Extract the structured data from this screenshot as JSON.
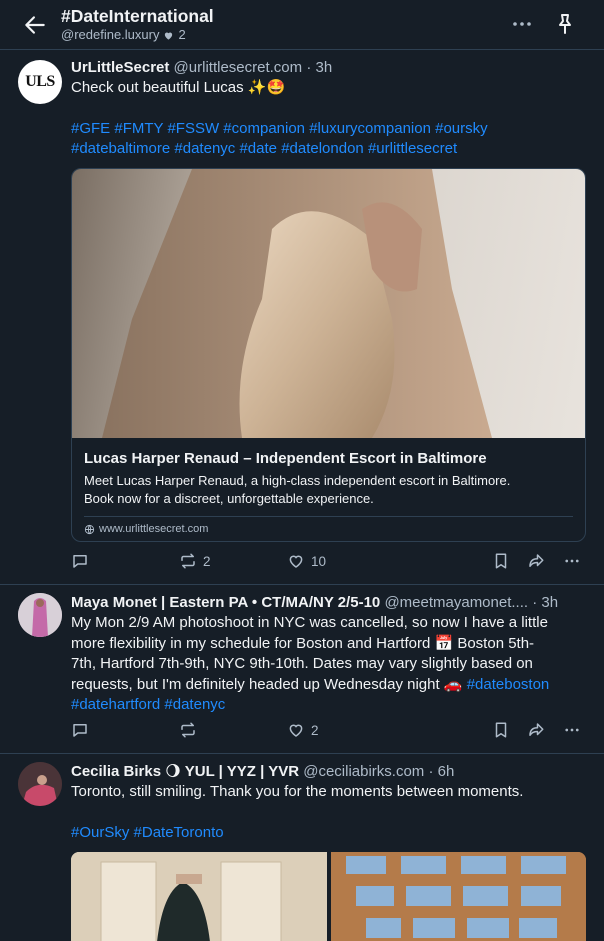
{
  "header": {
    "title": "#DateInternational",
    "subtitle": "@redefine.luxury",
    "likes": "2"
  },
  "posts": [
    {
      "name": "UrLittleSecret",
      "handle": "@urlittlesecret.com",
      "time": "· 3h",
      "avatar_text": "ULS",
      "text": "Check out beautiful Lucas ✨🤩",
      "tags_line1": [
        "#GFE",
        "#FMTY",
        "#FSSW",
        "#companion",
        "#luxurycompanion",
        "#oursky"
      ],
      "tags_line2": [
        "#datebaltimore",
        "#datenyc",
        "#date",
        "#datelondon",
        "#urlittlesecret"
      ],
      "card": {
        "title": "Lucas Harper Renaud – Independent Escort in Baltimore",
        "desc_line1": "Meet Lucas Harper Renaud, a high-class independent escort in Baltimore.",
        "desc_line2": "Book now for a discreet, unforgettable experience.",
        "url": "www.urlittlesecret.com"
      },
      "reposts": "2",
      "likes": "10"
    },
    {
      "name": "Maya Monet | Eastern PA • CT/MA/NY 2/5-10",
      "handle": "@meetmayamonet....",
      "time": "· 3h",
      "line1": "My Mon 2/9 AM photoshoot in NYC was cancelled, so now I have a little",
      "line2": "more flexibility in my schedule for Boston and Hartford 📅 Boston 5th-",
      "line3": "7th, Hartford 7th-9th, NYC 9th-10th. Dates may vary slightly based on",
      "line4": "requests, but I'm definitely headed up Wednesday night 🚗",
      "tag_inline": "#dateboston",
      "tags_line5": [
        "#datehartford",
        "#datenyc"
      ],
      "reposts": "",
      "likes": "2"
    },
    {
      "name": "Cecilia Birks",
      "name_extra": "🌖 YUL | YYZ | YVR",
      "handle": "@ceciliabirks.com",
      "time": "· 6h",
      "text": "Toronto, still smiling. Thank you for the moments between moments.",
      "tags": [
        "#OurSky",
        "#DateToronto"
      ]
    }
  ],
  "colors": {
    "background": "#161e27",
    "border": "#2e4052",
    "link": "#208bfe",
    "muted": "#aebbc9"
  }
}
